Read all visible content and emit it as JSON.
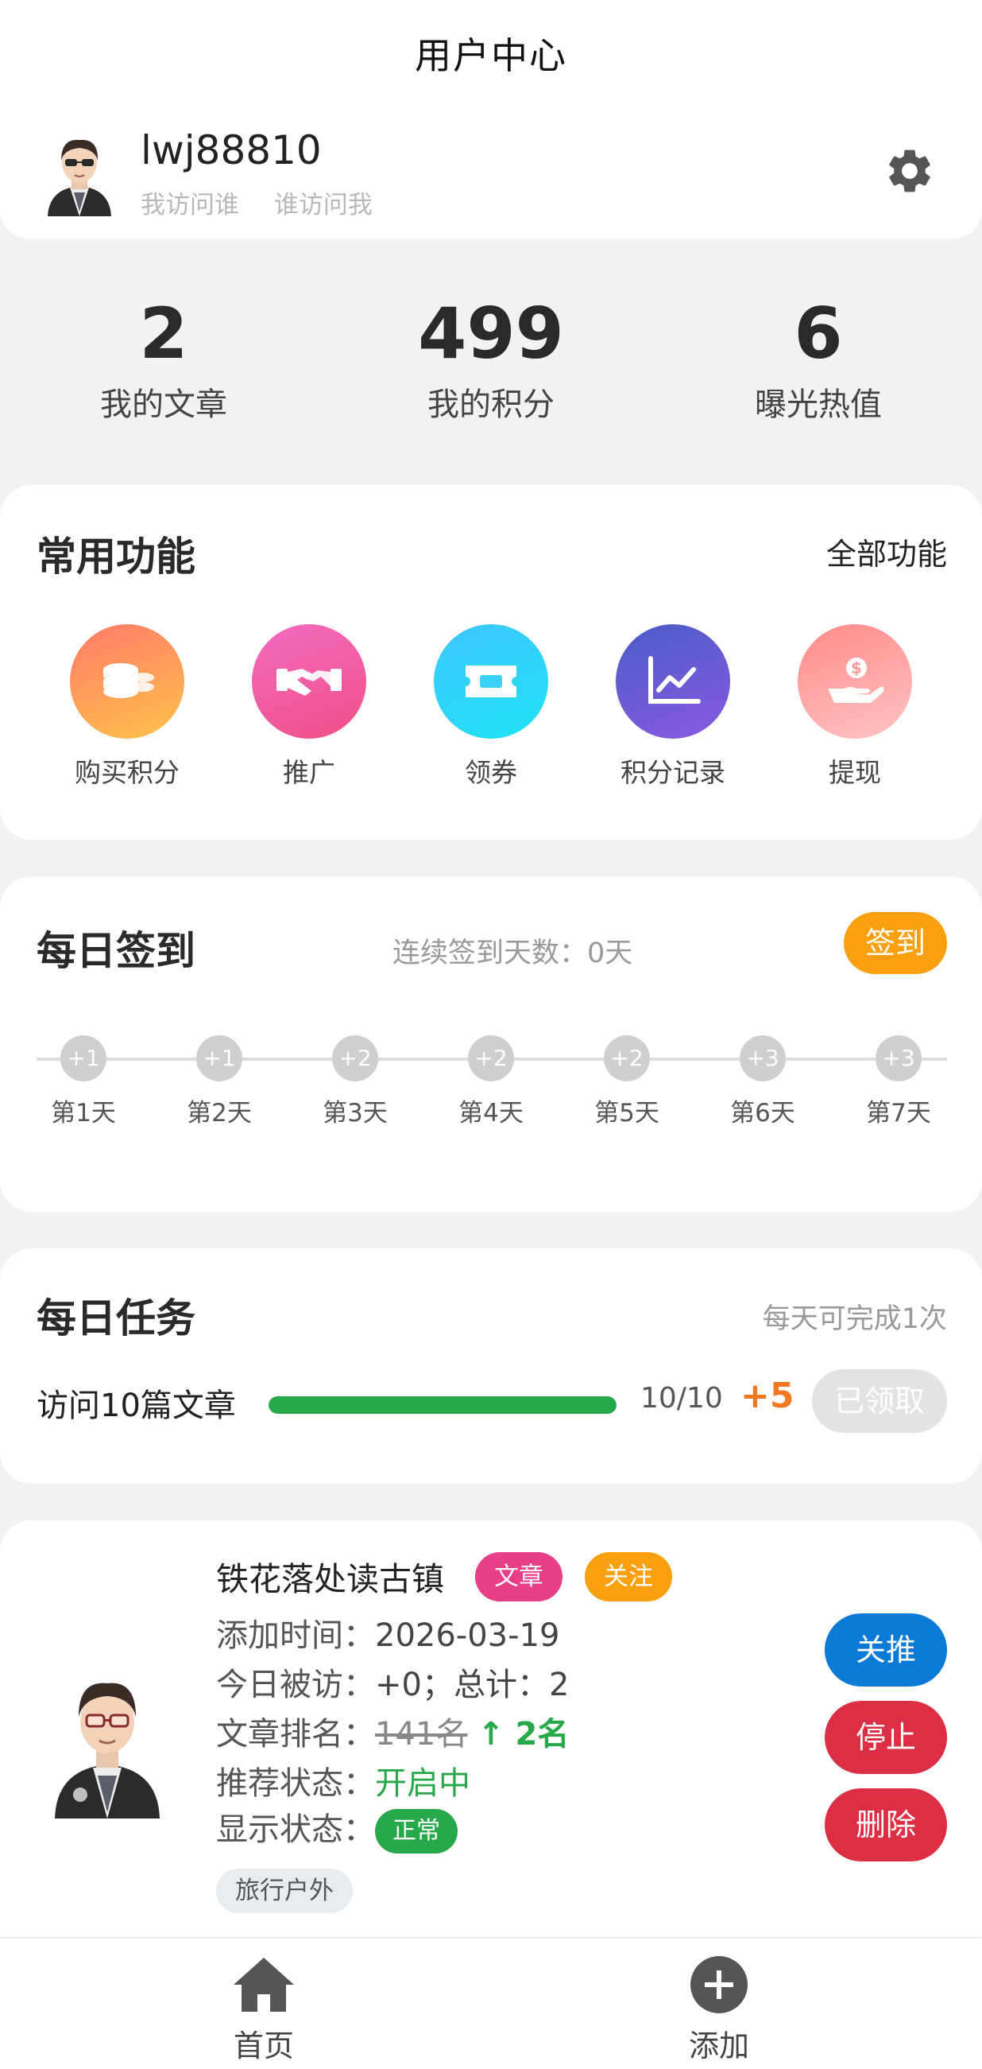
{
  "header": {
    "title": "用户中心"
  },
  "profile": {
    "username": "lwj88810",
    "links": [
      "我访问谁",
      "谁访问我"
    ]
  },
  "stats": [
    {
      "value": "2",
      "label": "我的文章"
    },
    {
      "value": "499",
      "label": "我的积分"
    },
    {
      "value": "6",
      "label": "曝光热值"
    }
  ],
  "functions": {
    "title": "常用功能",
    "all_label": "全部功能",
    "items": [
      {
        "label": "购买积分",
        "icon": "coins-icon"
      },
      {
        "label": "推广",
        "icon": "handshake-icon"
      },
      {
        "label": "领券",
        "icon": "ticket-icon"
      },
      {
        "label": "积分记录",
        "icon": "chart-icon"
      },
      {
        "label": "提现",
        "icon": "hand-dollar-icon"
      }
    ]
  },
  "checkin": {
    "title": "每日签到",
    "streak_text": "连续签到天数：0天",
    "button": "签到",
    "days": [
      {
        "reward": "+1",
        "label": "第1天"
      },
      {
        "reward": "+1",
        "label": "第2天"
      },
      {
        "reward": "+2",
        "label": "第3天"
      },
      {
        "reward": "+2",
        "label": "第4天"
      },
      {
        "reward": "+2",
        "label": "第5天"
      },
      {
        "reward": "+3",
        "label": "第6天"
      },
      {
        "reward": "+3",
        "label": "第7天"
      }
    ]
  },
  "task": {
    "title": "每日任务",
    "note": "每天可完成1次",
    "name": "访问10篇文章",
    "progress": 1.0,
    "count": "10/10",
    "reward": "+5",
    "button": "已领取"
  },
  "article": {
    "title": "铁花落处读古镇",
    "tags": [
      "文章",
      "关注"
    ],
    "added_label": "添加时间：",
    "added_value": "2026-03-19",
    "visits_label": "今日被访：",
    "visits_value": "+0；总计：2",
    "rank_label": "文章排名：",
    "rank_old": "141名",
    "rank_new": "↑ 2名",
    "recommend_label": "推荐状态：",
    "recommend_value": "开启中",
    "display_label": "显示状态：",
    "display_value": "正常",
    "category": "旅行户外",
    "actions": [
      "关推",
      "停止",
      "删除"
    ]
  },
  "nav": {
    "home": "首页",
    "add": "添加"
  },
  "colors": {
    "accent_orange": "#f8a010",
    "green": "#27a84a",
    "blue": "#0a7ad6",
    "red": "#dc2f46",
    "pink": "#e83d87"
  }
}
